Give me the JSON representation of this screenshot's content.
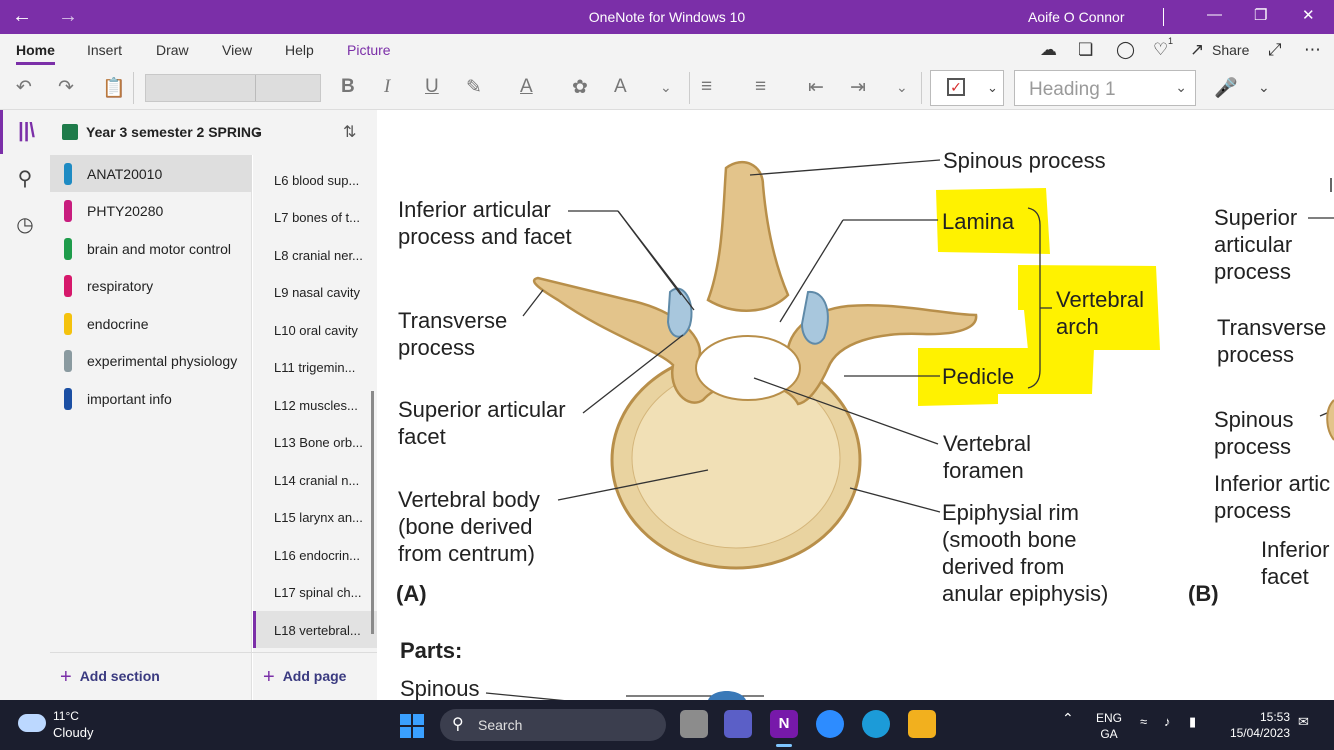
{
  "window": {
    "title": "OneNote for Windows 10",
    "user": "Aoife O Connor"
  },
  "ribbon": {
    "tabs": [
      "Home",
      "Insert",
      "Draw",
      "View",
      "Help",
      "Picture"
    ],
    "active_tab": "Home",
    "share_label": "Share",
    "notification_count": "1",
    "style_value": "Heading 1"
  },
  "notebook": {
    "title": "Year 3 semester 2 SPRING"
  },
  "sections": [
    {
      "label": "ANAT20010",
      "color": "#1e8bc3"
    },
    {
      "label": "PHTY20280",
      "color": "#c81d7e"
    },
    {
      "label": "brain and motor control",
      "color": "#1e9c4b"
    },
    {
      "label": "respiratory",
      "color": "#d6186b"
    },
    {
      "label": "endocrine",
      "color": "#f4c20d"
    },
    {
      "label": "experimental physiology",
      "color": "#8a9aa0"
    },
    {
      "label": "important info",
      "color": "#1b4fa3"
    }
  ],
  "pages": [
    "L6 blood sup...",
    "L7 bones of t...",
    "L8 cranial ner...",
    "L9 nasal cavity",
    "L10 oral cavity",
    "L11 trigemin...",
    "L12 muscles...",
    "L13 Bone orb...",
    "L14 cranial n...",
    "L15 larynx an...",
    "L16 endocrin...",
    "L17 spinal ch...",
    "L18 vertebral..."
  ],
  "add_section_label": "Add section",
  "add_page_label": "Add page",
  "diagram": {
    "labels": {
      "inferior_articular": "Inferior articular\nprocess and facet",
      "transverse": "Transverse\nprocess",
      "superior_facet": "Superior articular\nfacet",
      "vertebral_body": "Vertebral body\n(bone  derived\nfrom centrum)",
      "panel_a": "(A)",
      "spinous": "Spinous process",
      "lamina": "Lamina",
      "vertebral_arch": "Vertebral\narch",
      "pedicle": "Pedicle",
      "vertebral_foramen": "Vertebral\nforamen",
      "epiphysial_rim": "Epiphysial rim\n(smooth bone\nderived from\nanular epiphysis)",
      "b_superior": "Superior\narticular\nprocess",
      "b_transverse": "Transverse\nprocess",
      "b_spinous": "Spinous\nprocess",
      "b_inferior": "Inferior artic\nprocess",
      "b_inferior_facet": "Inferior\nfacet",
      "panel_b": "(B)"
    },
    "highlight_color": "#fff200"
  },
  "notes": {
    "heading": "Parts:",
    "first_item": "Spinous"
  },
  "taskbar": {
    "temperature": "11°C",
    "condition": "Cloudy",
    "search_label": "Search",
    "lang_line1": "ENG",
    "lang_line2": "GA",
    "time": "15:53",
    "date": "15/04/2023"
  }
}
